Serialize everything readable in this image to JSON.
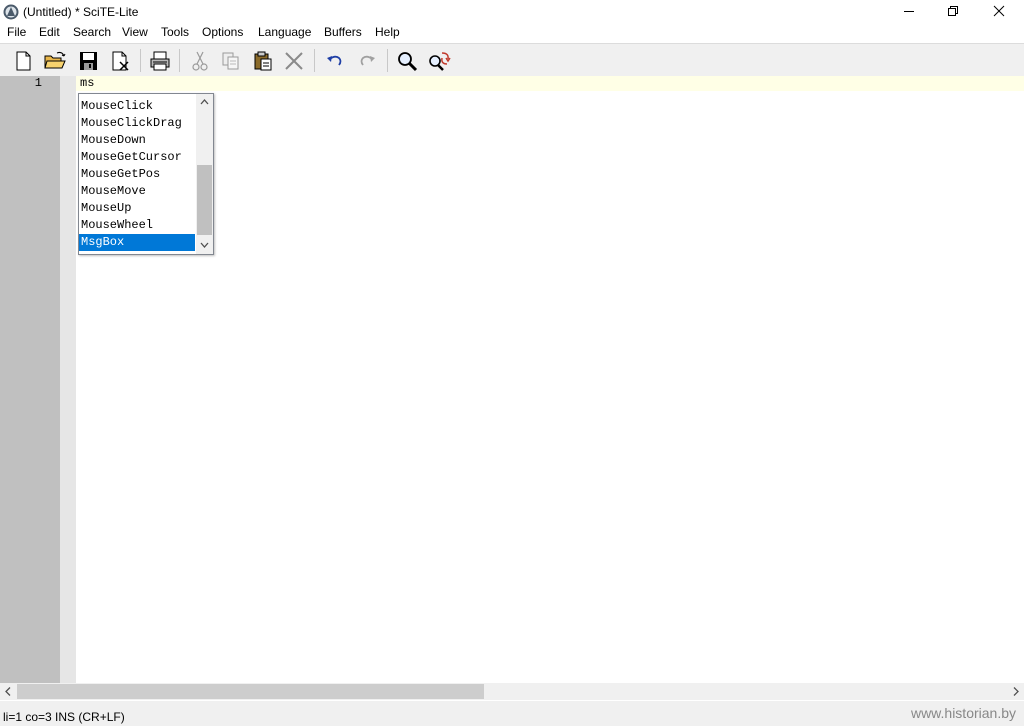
{
  "window": {
    "title": "(Untitled) * SciTE-Lite"
  },
  "menu": {
    "items": [
      "File",
      "Edit",
      "Search",
      "View",
      "Tools",
      "Options",
      "Language",
      "Buffers",
      "Help"
    ]
  },
  "toolbar": {
    "buttons": [
      "new-file-icon",
      "open-folder-icon",
      "save-icon",
      "close-file-icon",
      "print-icon",
      "cut-icon",
      "copy-icon",
      "paste-icon",
      "delete-icon",
      "undo-icon",
      "redo-icon",
      "find-icon",
      "replace-icon"
    ]
  },
  "editor": {
    "line_number": "1",
    "line_text": "ms"
  },
  "autocomplete": {
    "items": [
      "MouseClick",
      "MouseClickDrag",
      "MouseDown",
      "MouseGetCursor",
      "MouseGetPos",
      "MouseMove",
      "MouseUp",
      "MouseWheel",
      "MsgBox"
    ],
    "selected": "MsgBox"
  },
  "status": {
    "text": "li=1 co=3 INS (CR+LF)"
  },
  "watermark": "www.historian.by",
  "colors": {
    "selection": "#0078d7",
    "caret_line": "#ffffe6",
    "gutter": "#c0c0c0"
  }
}
